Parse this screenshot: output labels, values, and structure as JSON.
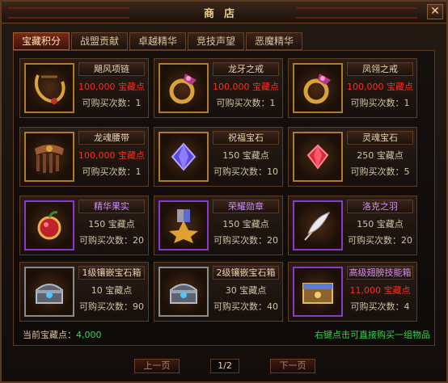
{
  "window": {
    "title": "商店",
    "close_glyph": "✕"
  },
  "tabs": [
    {
      "label": "宝藏积分",
      "active": true
    },
    {
      "label": "战盟贡献",
      "active": false
    },
    {
      "label": "卓越精华",
      "active": false
    },
    {
      "label": "竞技声望",
      "active": false
    },
    {
      "label": "恶魔精华",
      "active": false
    }
  ],
  "items": [
    {
      "name": "飓风项链",
      "cost": "100,000 宝藏点",
      "limit": "可购买次数：1",
      "icon": "necklace-icon",
      "frame": "gold",
      "cost_color": "red",
      "name_color": "normal"
    },
    {
      "name": "龙牙之戒",
      "cost": "100,000 宝藏点",
      "limit": "可购买次数：1",
      "icon": "ring-icon",
      "frame": "gold",
      "cost_color": "red",
      "name_color": "normal"
    },
    {
      "name": "凤翎之戒",
      "cost": "100,000 宝藏点",
      "limit": "可购买次数：1",
      "icon": "ring-icon",
      "frame": "gold",
      "cost_color": "red",
      "name_color": "normal"
    },
    {
      "name": "龙魂腰带",
      "cost": "100,000 宝藏点",
      "limit": "可购买次数：1",
      "icon": "belt-icon",
      "frame": "gold",
      "cost_color": "red",
      "name_color": "normal"
    },
    {
      "name": "祝福宝石",
      "cost": "150 宝藏点",
      "limit": "可购买次数：10",
      "icon": "blue-gem-icon",
      "frame": "gold",
      "cost_color": "normal",
      "name_color": "normal"
    },
    {
      "name": "灵魂宝石",
      "cost": "250 宝藏点",
      "limit": "可购买次数：5",
      "icon": "red-gem-icon",
      "frame": "gold",
      "cost_color": "normal",
      "name_color": "normal"
    },
    {
      "name": "精华果实",
      "cost": "150 宝藏点",
      "limit": "可购买次数：20",
      "icon": "fruit-icon",
      "frame": "purple",
      "cost_color": "normal",
      "name_color": "purple"
    },
    {
      "name": "荣耀勋章",
      "cost": "150 宝藏点",
      "limit": "可购买次数：20",
      "icon": "medal-icon",
      "frame": "purple",
      "cost_color": "normal",
      "name_color": "purple"
    },
    {
      "name": "洛克之羽",
      "cost": "150 宝藏点",
      "limit": "可购买次数：20",
      "icon": "feather-icon",
      "frame": "purple",
      "cost_color": "normal",
      "name_color": "purple"
    },
    {
      "name": "1级镶嵌宝石箱",
      "cost": "10 宝藏点",
      "limit": "可购买次数：90",
      "icon": "chest-icon",
      "frame": "gray",
      "cost_color": "normal",
      "name_color": "normal"
    },
    {
      "name": "2级镶嵌宝石箱",
      "cost": "30 宝藏点",
      "limit": "可购买次数：40",
      "icon": "chest-icon",
      "frame": "gray",
      "cost_color": "normal",
      "name_color": "normal"
    },
    {
      "name": "高级翅膀技能箱",
      "cost": "11,000 宝藏点",
      "limit": "可购买次数：4",
      "icon": "wing-box-icon",
      "frame": "purple",
      "cost_color": "red",
      "name_color": "purple"
    }
  ],
  "footer": {
    "points_label": "当前宝藏点：",
    "points_value": "4,000",
    "hint": "右键点击可直接购买一组物品"
  },
  "pager": {
    "prev": "上一页",
    "next": "下一页",
    "page": "1/2"
  }
}
